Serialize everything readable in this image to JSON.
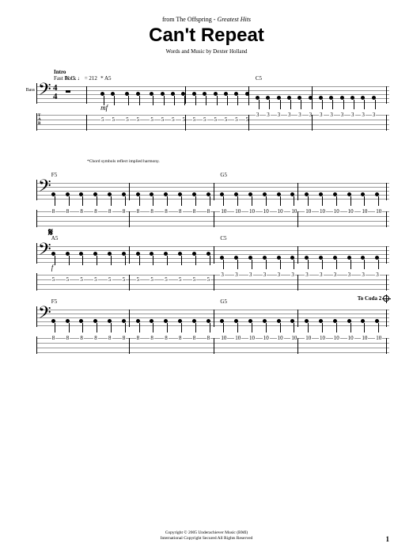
{
  "header": {
    "from_prefix": "from The Offspring - ",
    "album": "Greatest Hits",
    "title": "Can't Repeat",
    "credits": "Words and Music by Dexter Holland"
  },
  "tempo": {
    "section": "Intro",
    "marking": "Fast Rock ♩ = 212"
  },
  "instrument_label": "Bass",
  "time_signature": {
    "top": "4",
    "bottom": "4"
  },
  "tab_clef": "T\nA\nB",
  "systems": [
    {
      "chords": [
        {
          "label": "N.C.",
          "pos": 8
        },
        {
          "label": "* A5",
          "pos": 18
        },
        {
          "label": "C5",
          "pos": 62
        }
      ],
      "dynamic": {
        "label": "mf",
        "pos": 18
      },
      "tab_numbers": [
        {
          "v": "5",
          "string": 2,
          "pos": 18
        },
        {
          "v": "5",
          "string": 2,
          "pos": 21
        },
        {
          "v": "5",
          "string": 2,
          "pos": 25
        },
        {
          "v": "5",
          "string": 2,
          "pos": 28
        },
        {
          "v": "5",
          "string": 2,
          "pos": 32
        },
        {
          "v": "5",
          "string": 2,
          "pos": 35
        },
        {
          "v": "5",
          "string": 2,
          "pos": 38
        },
        {
          "v": "5",
          "string": 2,
          "pos": 41
        },
        {
          "v": "5",
          "string": 2,
          "pos": 44
        },
        {
          "v": "5",
          "string": 2,
          "pos": 47
        },
        {
          "v": "5",
          "string": 2,
          "pos": 50
        },
        {
          "v": "5",
          "string": 2,
          "pos": 53
        },
        {
          "v": "5",
          "string": 2,
          "pos": 56
        },
        {
          "v": "5",
          "string": 2,
          "pos": 59
        },
        {
          "v": "3",
          "string": 1,
          "pos": 62
        },
        {
          "v": "3",
          "string": 1,
          "pos": 65
        },
        {
          "v": "3",
          "string": 1,
          "pos": 68
        },
        {
          "v": "3",
          "string": 1,
          "pos": 71
        },
        {
          "v": "3",
          "string": 1,
          "pos": 74
        },
        {
          "v": "3",
          "string": 1,
          "pos": 77
        },
        {
          "v": "3",
          "string": 1,
          "pos": 80
        },
        {
          "v": "3",
          "string": 1,
          "pos": 83
        },
        {
          "v": "3",
          "string": 1,
          "pos": 86
        },
        {
          "v": "3",
          "string": 1,
          "pos": 89
        },
        {
          "v": "3",
          "string": 1,
          "pos": 92
        },
        {
          "v": "3",
          "string": 1,
          "pos": 95
        }
      ],
      "barlines": [
        14,
        42,
        60,
        78,
        99
      ],
      "footnote": "*Chord symbols reflect implied harmony."
    },
    {
      "chords": [
        {
          "label": "F5",
          "pos": 4
        },
        {
          "label": "G5",
          "pos": 52
        }
      ],
      "tab_numbers": [
        {
          "v": "8",
          "string": 1,
          "pos": 4
        },
        {
          "v": "8",
          "string": 1,
          "pos": 8
        },
        {
          "v": "8",
          "string": 1,
          "pos": 12
        },
        {
          "v": "8",
          "string": 1,
          "pos": 16
        },
        {
          "v": "8",
          "string": 1,
          "pos": 20
        },
        {
          "v": "8",
          "string": 1,
          "pos": 24
        },
        {
          "v": "8",
          "string": 1,
          "pos": 28
        },
        {
          "v": "8",
          "string": 1,
          "pos": 32
        },
        {
          "v": "8",
          "string": 1,
          "pos": 36
        },
        {
          "v": "8",
          "string": 1,
          "pos": 40
        },
        {
          "v": "8",
          "string": 1,
          "pos": 44
        },
        {
          "v": "8",
          "string": 1,
          "pos": 48
        },
        {
          "v": "10",
          "string": 1,
          "pos": 52
        },
        {
          "v": "10",
          "string": 1,
          "pos": 56
        },
        {
          "v": "10",
          "string": 1,
          "pos": 60
        },
        {
          "v": "10",
          "string": 1,
          "pos": 64
        },
        {
          "v": "10",
          "string": 1,
          "pos": 68
        },
        {
          "v": "10",
          "string": 1,
          "pos": 72
        },
        {
          "v": "10",
          "string": 1,
          "pos": 76
        },
        {
          "v": "10",
          "string": 1,
          "pos": 80
        },
        {
          "v": "10",
          "string": 1,
          "pos": 84
        },
        {
          "v": "10",
          "string": 1,
          "pos": 88
        },
        {
          "v": "10",
          "string": 1,
          "pos": 92
        },
        {
          "v": "10",
          "string": 1,
          "pos": 96
        }
      ],
      "barlines": [
        26,
        50,
        74,
        99
      ]
    },
    {
      "segno": "𝄋",
      "chords": [
        {
          "label": "A5",
          "pos": 4
        },
        {
          "label": "C5",
          "pos": 52
        }
      ],
      "dynamic": {
        "label": "f",
        "pos": 4
      },
      "tab_numbers": [
        {
          "v": "5",
          "string": 2,
          "pos": 4
        },
        {
          "v": "5",
          "string": 2,
          "pos": 8
        },
        {
          "v": "5",
          "string": 2,
          "pos": 12
        },
        {
          "v": "5",
          "string": 2,
          "pos": 16
        },
        {
          "v": "5",
          "string": 2,
          "pos": 20
        },
        {
          "v": "5",
          "string": 2,
          "pos": 24
        },
        {
          "v": "5",
          "string": 2,
          "pos": 28
        },
        {
          "v": "5",
          "string": 2,
          "pos": 32
        },
        {
          "v": "5",
          "string": 2,
          "pos": 36
        },
        {
          "v": "5",
          "string": 2,
          "pos": 40
        },
        {
          "v": "5",
          "string": 2,
          "pos": 44
        },
        {
          "v": "5",
          "string": 2,
          "pos": 48
        },
        {
          "v": "3",
          "string": 1,
          "pos": 52
        },
        {
          "v": "3",
          "string": 1,
          "pos": 56
        },
        {
          "v": "3",
          "string": 1,
          "pos": 60
        },
        {
          "v": "3",
          "string": 1,
          "pos": 64
        },
        {
          "v": "3",
          "string": 1,
          "pos": 68
        },
        {
          "v": "3",
          "string": 1,
          "pos": 72
        },
        {
          "v": "3",
          "string": 1,
          "pos": 76
        },
        {
          "v": "3",
          "string": 1,
          "pos": 80
        },
        {
          "v": "3",
          "string": 1,
          "pos": 84
        },
        {
          "v": "3",
          "string": 1,
          "pos": 88
        },
        {
          "v": "3",
          "string": 1,
          "pos": 92
        },
        {
          "v": "3",
          "string": 1,
          "pos": 96
        }
      ],
      "barlines": [
        26,
        50,
        74,
        99
      ]
    },
    {
      "coda": "To Coda 2",
      "chords": [
        {
          "label": "F5",
          "pos": 4
        },
        {
          "label": "G5",
          "pos": 52
        }
      ],
      "tab_numbers": [
        {
          "v": "8",
          "string": 1,
          "pos": 4
        },
        {
          "v": "8",
          "string": 1,
          "pos": 8
        },
        {
          "v": "8",
          "string": 1,
          "pos": 12
        },
        {
          "v": "8",
          "string": 1,
          "pos": 16
        },
        {
          "v": "8",
          "string": 1,
          "pos": 20
        },
        {
          "v": "8",
          "string": 1,
          "pos": 24
        },
        {
          "v": "8",
          "string": 1,
          "pos": 28
        },
        {
          "v": "8",
          "string": 1,
          "pos": 32
        },
        {
          "v": "8",
          "string": 1,
          "pos": 36
        },
        {
          "v": "8",
          "string": 1,
          "pos": 40
        },
        {
          "v": "8",
          "string": 1,
          "pos": 44
        },
        {
          "v": "8",
          "string": 1,
          "pos": 48
        },
        {
          "v": "10",
          "string": 1,
          "pos": 52
        },
        {
          "v": "10",
          "string": 1,
          "pos": 56
        },
        {
          "v": "10",
          "string": 1,
          "pos": 60
        },
        {
          "v": "10",
          "string": 1,
          "pos": 64
        },
        {
          "v": "10",
          "string": 1,
          "pos": 68
        },
        {
          "v": "10",
          "string": 1,
          "pos": 72
        },
        {
          "v": "10",
          "string": 1,
          "pos": 76
        },
        {
          "v": "10",
          "string": 1,
          "pos": 80
        },
        {
          "v": "10",
          "string": 1,
          "pos": 84
        },
        {
          "v": "10",
          "string": 1,
          "pos": 88
        },
        {
          "v": "10",
          "string": 1,
          "pos": 92
        },
        {
          "v": "10",
          "string": 1,
          "pos": 96
        }
      ],
      "barlines": [
        26,
        50,
        74,
        99
      ]
    }
  ],
  "copyright": {
    "line1": "Copyright © 2005 Underachiever Music (BMI)",
    "line2": "International Copyright Secured   All Rights Reserved"
  },
  "page_number": "1"
}
